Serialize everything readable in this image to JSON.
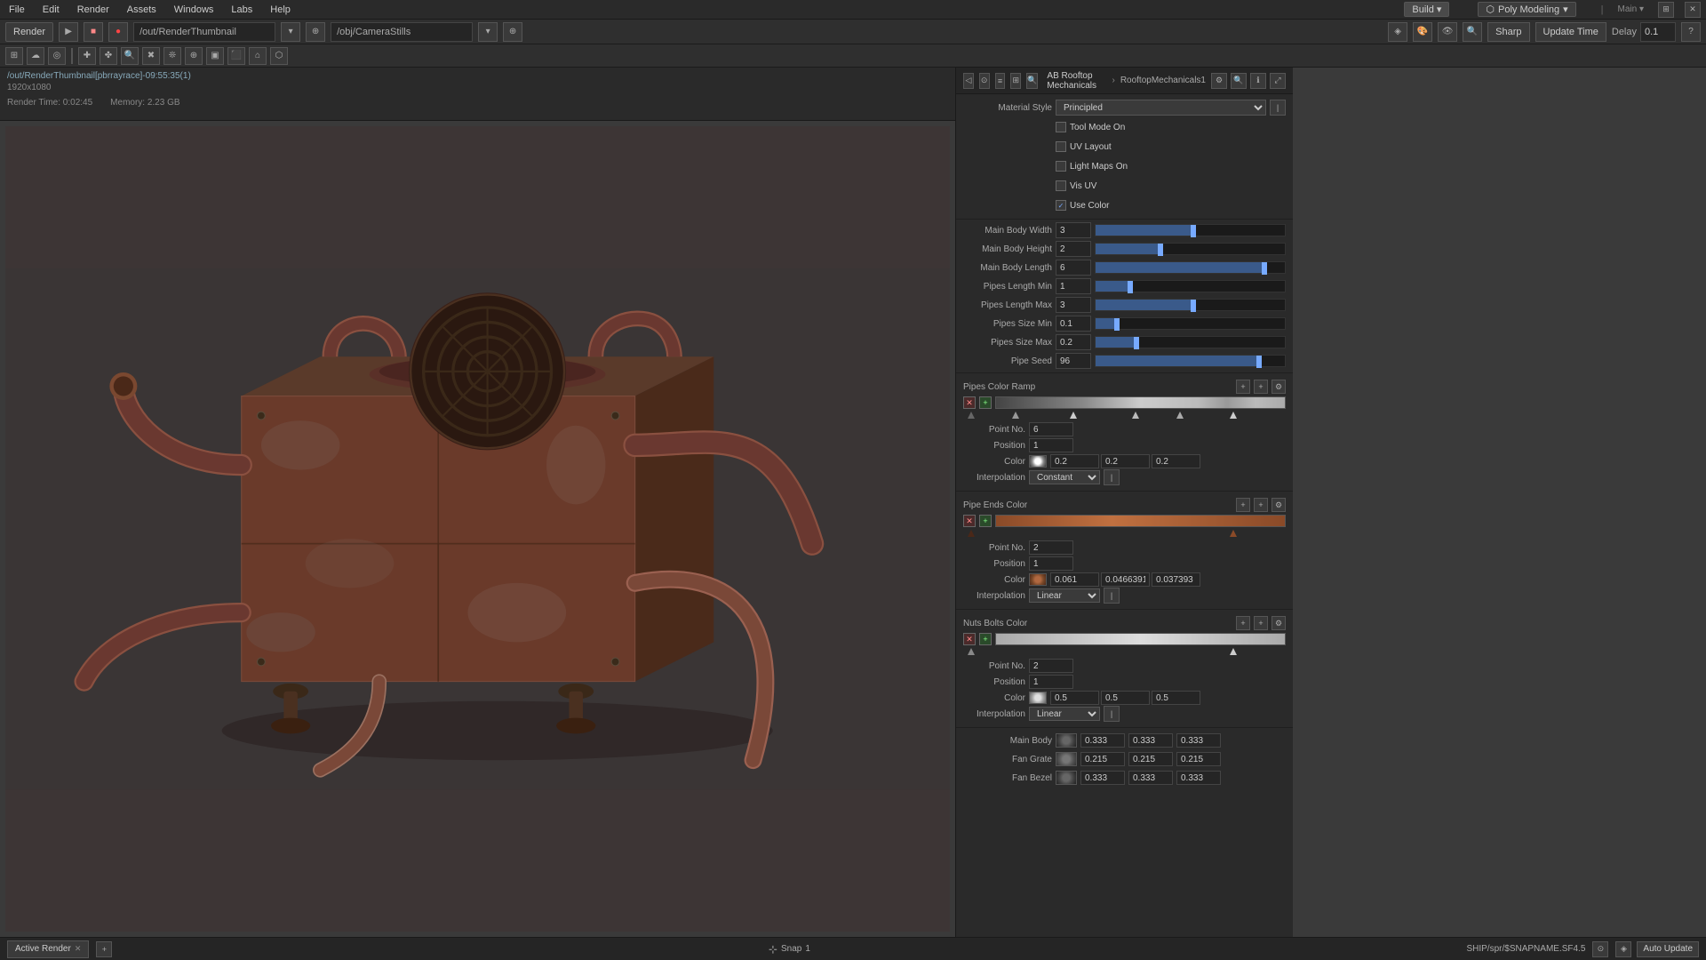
{
  "topMenu": {
    "items": [
      "File",
      "Edit",
      "Render",
      "Assets",
      "Windows",
      "Labs",
      "Help"
    ],
    "buildLabel": "Build",
    "polyModelingLabel": "Poly Modeling",
    "dropdownArrow": "▾"
  },
  "toolbar": {
    "renderLabel": "Render",
    "pathValue": "/out/RenderThumbnail",
    "cameraPath": "/obj/CameraStills",
    "sharpLabel": "Sharp",
    "updateTimeLabel": "Update Time",
    "delayLabel": "Delay",
    "delayValue": "0.1",
    "helpIcon": "?"
  },
  "toolbar2": {
    "icons": [
      "⊞",
      "☁",
      "●",
      "⬚",
      "✚",
      "◈",
      "⊙",
      "✤",
      "🔍",
      "✖",
      "❊",
      "⊕",
      "▣",
      "⬛",
      "⌂",
      "⬡"
    ]
  },
  "infoBar": {
    "path": "/out/RenderThumbnail[pbrrayrace]-09:55:35(1)",
    "resolution": "1920x1080",
    "stats1": "1920x1080",
    "renderTime": "Render Time: 0:02:45",
    "memory": "Memory: 2.23 GB"
  },
  "rightPanel": {
    "nodeTitle": "AB Rooftop Mechanicals",
    "nodePath": "RooftopMechanicals1",
    "materialStyle": "Principled",
    "checkboxes": {
      "toolModeOn": false,
      "uvLayout": false,
      "lightMapsOn": false,
      "visUV": false,
      "useColor": true
    },
    "params": {
      "mainBodyWidth": {
        "label": "Main Body Width",
        "value": "3",
        "fillPct": 0.5
      },
      "mainBodyHeight": {
        "label": "Main Body Height",
        "value": "2",
        "fillPct": 0.33
      },
      "mainBodyLength": {
        "label": "Main Body Length",
        "value": "6",
        "fillPct": 0.9
      },
      "pipesLengthMin": {
        "label": "Pipes Length Min",
        "value": "1",
        "fillPct": 0.17
      },
      "pipesLengthMax": {
        "label": "Pipes Length Max",
        "value": "3",
        "fillPct": 0.5
      },
      "pipesSizeMin": {
        "label": "Pipes Size Min",
        "value": "0.1",
        "fillPct": 0.1
      },
      "pipesSizeMax": {
        "label": "Pipes Size Max",
        "value": "0.2",
        "fillPct": 0.2
      },
      "pipeSeed": {
        "label": "Pipe Seed",
        "value": "96",
        "fillPct": 0.85
      }
    },
    "pipesColorRamp": {
      "title": "Pipes Color Ramp",
      "pointNo": "6",
      "position": "1",
      "colorValues": [
        "0.2",
        "0.2",
        "0.2"
      ],
      "interpolation": "Constant",
      "gradient": "linear-gradient(to right, #444 0%, #888 30%, #ccc 50%, #888 70%, #444 100%)"
    },
    "pipeEndsColor": {
      "title": "Pipe Ends Color",
      "pointNo": "2",
      "position": "1",
      "colorValues": [
        "0.061",
        "0.0466391",
        "0.037393"
      ],
      "colorHex": "#7a3a28",
      "interpolation": "Linear",
      "gradient": "linear-gradient(to right, #5a2a1a 0%, #8a4a30 60%, #3a1a0a 100%)"
    },
    "nutsBoltsColor": {
      "title": "Nuts Bolts Color",
      "pointNo": "2",
      "position": "1",
      "colorValues": [
        "0.5",
        "0.5",
        "0.5"
      ],
      "colorHex": "#808080",
      "interpolation": "Linear",
      "gradient": "linear-gradient(to right, #888 0%, #fff 50%, #888 100%)"
    },
    "colorRows": [
      {
        "label": "Main Body",
        "colorHex": "#3a3a3a",
        "values": [
          "0.333",
          "0.333",
          "0.333"
        ]
      },
      {
        "label": "Fan Grate",
        "colorHex": "#404040",
        "values": [
          "0.215",
          "0.215",
          "0.215"
        ]
      },
      {
        "label": "Fan Bezel",
        "colorHex": "#444444",
        "values": [
          "0.333",
          "0.333",
          "0.333"
        ]
      }
    ]
  },
  "bottomBar": {
    "tabLabel": "Active Render",
    "snapLabel": "Snap",
    "snapValue": "1",
    "pathInfo": "SHIP/spr/$SNAPNAME.SF4.5",
    "autoUpdateLabel": "Auto Update"
  }
}
